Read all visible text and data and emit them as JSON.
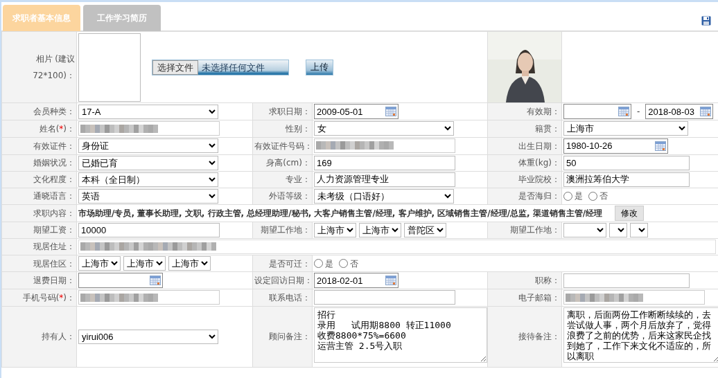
{
  "tabs": [
    {
      "label": "求职者基本信息",
      "selected": true
    },
    {
      "label": "工作学习简历",
      "selected": false
    }
  ],
  "photo": {
    "label": "相片 (建议72*100)：",
    "file_button": "选择文件",
    "file_status": "未选择任何文件",
    "upload_button": "上传",
    "kind": "picture"
  },
  "rows": [
    {
      "cells": [
        {
          "label": "会员种类：",
          "field": {
            "kind": "select",
            "value": "17-A"
          }
        },
        {
          "label": "求职日期：",
          "field": {
            "kind": "date",
            "value": "2009-05-01"
          }
        },
        {
          "label": "有效期：",
          "field": {
            "kind": "date_range",
            "separator": "-",
            "to": "2018-08-03"
          }
        }
      ]
    },
    {
      "cells": [
        {
          "label": "姓名(",
          "required_mark": "*",
          "label_end": ")：",
          "field": {
            "kind": "redacted"
          }
        },
        {
          "label": "性别：",
          "field": {
            "kind": "select",
            "value": "女"
          }
        },
        {
          "label": "籍贯：",
          "field": {
            "kind": "select",
            "value": "上海市"
          }
        }
      ]
    },
    {
      "cells": [
        {
          "label": "有效证件：",
          "field": {
            "kind": "select",
            "value": "身份证"
          }
        },
        {
          "label": "有效证件号码：",
          "field": {
            "kind": "redacted"
          }
        },
        {
          "label": "出生日期：",
          "field": {
            "kind": "date",
            "value": "1980-10-26"
          }
        }
      ]
    },
    {
      "cells": [
        {
          "label": "婚姻状况：",
          "field": {
            "kind": "select",
            "value": "已婚已育"
          }
        },
        {
          "label": "身高(cm)：",
          "field": {
            "kind": "text",
            "value": "169"
          }
        },
        {
          "label": "体重(kg)：",
          "field": {
            "kind": "text",
            "value": "50"
          }
        }
      ]
    },
    {
      "cells": [
        {
          "label": "文化程度：",
          "field": {
            "kind": "select",
            "value": "本科（全日制）"
          }
        },
        {
          "label": "专业：",
          "field": {
            "kind": "text",
            "value": "人力资源管理专业"
          }
        },
        {
          "label": "毕业院校：",
          "field": {
            "kind": "text",
            "value": "澳洲拉筹伯大学"
          }
        }
      ]
    },
    {
      "cells": [
        {
          "label": "通晓语言：",
          "field": {
            "kind": "select",
            "value": "英语"
          }
        },
        {
          "label": "外语等级：",
          "field": {
            "kind": "select",
            "value": "未考级（口语好）"
          }
        },
        {
          "label": "是否海归：",
          "field": {
            "kind": "radio",
            "options": [
              {
                "label": "是",
                "selected": false
              },
              {
                "label": "否",
                "selected": false
              }
            ]
          }
        }
      ]
    },
    {
      "cells": [
        {
          "label": "求职内容：",
          "field": {
            "kind": "summary",
            "value": "市场助理/专员, 董事长助理, 文职, 行政主管, 总经理助理/秘书, 大客户销售主管/经理, 客户维护, 区域销售主管/经理/总监, 渠道销售主管/经理",
            "button": "修改"
          }
        }
      ]
    },
    {
      "cells": [
        {
          "label": "期望工资：",
          "field": {
            "kind": "text",
            "value": "10000"
          }
        },
        {
          "label": "期望工作地：",
          "field": {
            "kind": "selects",
            "values": [
              "上海市",
              "上海市",
              "普陀区"
            ]
          }
        },
        {
          "label": "期望工作地：",
          "field": {
            "kind": "selects",
            "values": [
              {
                "kind": "blank"
              },
              {
                "kind": "blank"
              },
              {
                "kind": "blank"
              }
            ]
          }
        }
      ]
    },
    {
      "cells": [
        {
          "label": "现居住址：",
          "field": {
            "kind": "redacted_wide"
          }
        }
      ]
    },
    {
      "cells": [
        {
          "label": "现居住区：",
          "field": {
            "kind": "selects",
            "values": [
              "上海市",
              "上海市",
              "上海市"
            ]
          }
        },
        {
          "label": "是否可迁：",
          "field": {
            "kind": "radio",
            "options": [
              {
                "label": "是",
                "selected": false
              },
              {
                "label": "否",
                "selected": false
              }
            ]
          }
        }
      ]
    },
    {
      "cells": [
        {
          "label": "退费日期：",
          "field": {
            "kind": "date"
          }
        },
        {
          "label": "设定回访日期：",
          "field": {
            "kind": "date",
            "value": "2018-02-01"
          }
        },
        {
          "label": "职称：",
          "field": {
            "kind": "text"
          }
        }
      ]
    },
    {
      "cells": [
        {
          "label": "手机号码(",
          "required_mark": "*",
          "label_end": ")：",
          "field": {
            "kind": "redacted"
          }
        },
        {
          "label": "联系电话：",
          "field": {
            "kind": "text"
          }
        },
        {
          "label": "电子邮箱：",
          "field": {
            "kind": "redacted"
          }
        }
      ]
    },
    {
      "cells": [
        {
          "label": "持有人：",
          "field": {
            "kind": "select",
            "value": "yirui006"
          }
        },
        {
          "label": "顾问备注：",
          "field": {
            "kind": "textarea",
            "lines": [
              "招行",
              "录用   试用期8800 转正11000",
              "收费8800*75%=6600",
              "运营主管 2.5号入职"
            ]
          }
        },
        {
          "label": "接待备注：",
          "field": {
            "kind": "textarea",
            "lines": [
              "离职，后面两份工作断断续续的，去尝试做人事，两个月后放弃了，觉得浪费了之前的优势，后来这家民企找到她了，工作下来文化不适应的，所以离职"
            ]
          }
        }
      ]
    }
  ]
}
